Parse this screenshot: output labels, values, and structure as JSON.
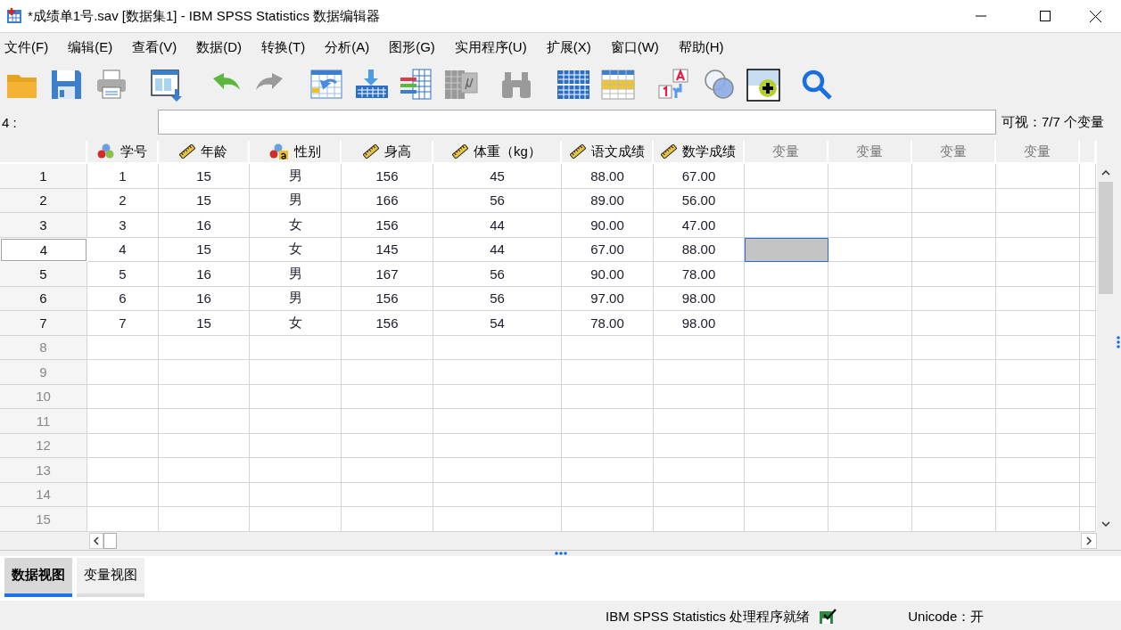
{
  "window": {
    "title": "*成绩单1号.sav [数据集1] - IBM SPSS Statistics 数据编辑器"
  },
  "menu": [
    {
      "label": "文件(F)"
    },
    {
      "label": "编辑(E)"
    },
    {
      "label": "查看(V)"
    },
    {
      "label": "数据(D)"
    },
    {
      "label": "转换(T)"
    },
    {
      "label": "分析(A)"
    },
    {
      "label": "图形(G)"
    },
    {
      "label": "实用程序(U)"
    },
    {
      "label": "扩展(X)"
    },
    {
      "label": "窗口(W)"
    },
    {
      "label": "帮助(H)"
    }
  ],
  "toolbar": [
    {
      "kind": "open",
      "disabled": false
    },
    {
      "kind": "save",
      "disabled": false
    },
    {
      "kind": "print",
      "disabled": false
    },
    {
      "kind": "recall",
      "disabled": false
    },
    {
      "kind": "undo",
      "disabled": false
    },
    {
      "kind": "redo",
      "disabled": true
    },
    {
      "kind": "goto_case",
      "disabled": false
    },
    {
      "kind": "goto_variable",
      "disabled": false
    },
    {
      "kind": "variables",
      "disabled": false
    },
    {
      "kind": "descriptives",
      "disabled": true
    },
    {
      "kind": "find",
      "disabled": true
    },
    {
      "kind": "insert_cases",
      "disabled": false
    },
    {
      "kind": "insert_variable",
      "disabled": false
    },
    {
      "kind": "value_labels",
      "disabled": false
    },
    {
      "kind": "use_sets",
      "disabled": false
    },
    {
      "kind": "show_all",
      "disabled": false
    },
    {
      "kind": "search",
      "disabled": false
    }
  ],
  "cell_editor": {
    "cell_ref": "4 :",
    "visible_vars": "可视：7/7 个变量"
  },
  "table": {
    "columns": [
      {
        "name": "学号",
        "kind": "nominal"
      },
      {
        "name": "年龄",
        "kind": "scale"
      },
      {
        "name": "性别",
        "kind": "nominal_string"
      },
      {
        "name": "身高",
        "kind": "scale"
      },
      {
        "name": "体重（kg）",
        "kind": "scale"
      },
      {
        "name": "语文成绩",
        "kind": "scale"
      },
      {
        "name": "数学成绩",
        "kind": "scale"
      },
      {
        "name": "变量",
        "kind": "empty"
      },
      {
        "name": "变量",
        "kind": "empty"
      },
      {
        "name": "变量",
        "kind": "empty"
      },
      {
        "name": "变量",
        "kind": "empty"
      }
    ],
    "rows": [
      {
        "number": "1",
        "selected": false,
        "cells": [
          {
            "value": "1"
          },
          {
            "value": "15"
          },
          {
            "value": "男"
          },
          {
            "value": "156"
          },
          {
            "value": "45"
          },
          {
            "value": "88.00"
          },
          {
            "value": "67.00"
          },
          {
            "selected": false
          },
          {
            "selected": false
          },
          {
            "selected": false
          },
          {
            "selected": false
          }
        ]
      },
      {
        "number": "2",
        "selected": false,
        "cells": [
          {
            "value": "2"
          },
          {
            "value": "15"
          },
          {
            "value": "男"
          },
          {
            "value": "166"
          },
          {
            "value": "56"
          },
          {
            "value": "89.00"
          },
          {
            "value": "56.00"
          },
          {
            "selected": false
          },
          {
            "selected": false
          },
          {
            "selected": false
          },
          {
            "selected": false
          }
        ]
      },
      {
        "number": "3",
        "selected": false,
        "cells": [
          {
            "value": "3"
          },
          {
            "value": "16"
          },
          {
            "value": "女"
          },
          {
            "value": "156"
          },
          {
            "value": "44"
          },
          {
            "value": "90.00"
          },
          {
            "value": "47.00"
          },
          {
            "selected": false
          },
          {
            "selected": false
          },
          {
            "selected": false
          },
          {
            "selected": false
          }
        ]
      },
      {
        "number": "4",
        "selected": true,
        "cells": [
          {
            "value": "4"
          },
          {
            "value": "15"
          },
          {
            "value": "女"
          },
          {
            "value": "145"
          },
          {
            "value": "44"
          },
          {
            "value": "67.00"
          },
          {
            "value": "88.00"
          },
          {
            "selected": true
          },
          {
            "selected": false
          },
          {
            "selected": false
          },
          {
            "selected": false
          }
        ]
      },
      {
        "number": "5",
        "selected": false,
        "cells": [
          {
            "value": "5"
          },
          {
            "value": "16"
          },
          {
            "value": "男"
          },
          {
            "value": "167"
          },
          {
            "value": "56"
          },
          {
            "value": "90.00"
          },
          {
            "value": "78.00"
          },
          {
            "selected": false
          },
          {
            "selected": false
          },
          {
            "selected": false
          },
          {
            "selected": false
          }
        ]
      },
      {
        "number": "6",
        "selected": false,
        "cells": [
          {
            "value": "6"
          },
          {
            "value": "16"
          },
          {
            "value": "男"
          },
          {
            "value": "156"
          },
          {
            "value": "56"
          },
          {
            "value": "97.00"
          },
          {
            "value": "98.00"
          },
          {
            "selected": false
          },
          {
            "selected": false
          },
          {
            "selected": false
          },
          {
            "selected": false
          }
        ]
      },
      {
        "number": "7",
        "selected": false,
        "cells": [
          {
            "value": "7"
          },
          {
            "value": "15"
          },
          {
            "value": "女"
          },
          {
            "value": "156"
          },
          {
            "value": "54"
          },
          {
            "value": "78.00"
          },
          {
            "value": "98.00"
          },
          {
            "selected": false
          },
          {
            "selected": false
          },
          {
            "selected": false
          },
          {
            "selected": false
          }
        ]
      },
      {
        "number": "8",
        "selected": false,
        "kind": "empty"
      },
      {
        "number": "9",
        "selected": false,
        "kind": "empty"
      },
      {
        "number": "10",
        "selected": false,
        "kind": "empty"
      },
      {
        "number": "11",
        "selected": false,
        "kind": "empty"
      },
      {
        "number": "12",
        "selected": false,
        "kind": "empty"
      },
      {
        "number": "13",
        "selected": false,
        "kind": "empty"
      },
      {
        "number": "14",
        "selected": false,
        "kind": "empty"
      },
      {
        "number": "15",
        "selected": false,
        "kind": "empty"
      }
    ]
  },
  "tabs": [
    {
      "label": "数据视图",
      "selected": true
    },
    {
      "label": "变量视图",
      "selected": false
    }
  ],
  "status_bar": {
    "processor": "IBM SPSS Statistics 处理程序就绪",
    "unicode": "Unicode：开"
  }
}
